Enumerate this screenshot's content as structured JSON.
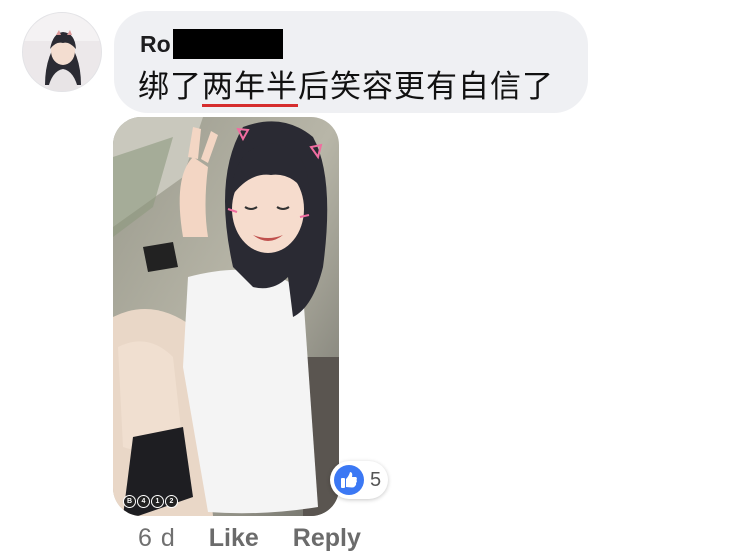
{
  "comment": {
    "author_visible": "Ro",
    "author_redacted": true,
    "text_before": "绑了",
    "text_highlight": "两年半",
    "text_after": "后笑容更有自信了",
    "highlight_color": "#d62d2d"
  },
  "photo_watermark": [
    "B",
    "4",
    "1",
    "2"
  ],
  "reaction": {
    "type": "like-icon",
    "count": "5",
    "color": "#3b78f4"
  },
  "actions": {
    "time": "6 d",
    "like_label": "Like",
    "reply_label": "Reply"
  },
  "colors": {
    "bubble": "#eff0f3",
    "action_text": "#6b6b6b"
  }
}
